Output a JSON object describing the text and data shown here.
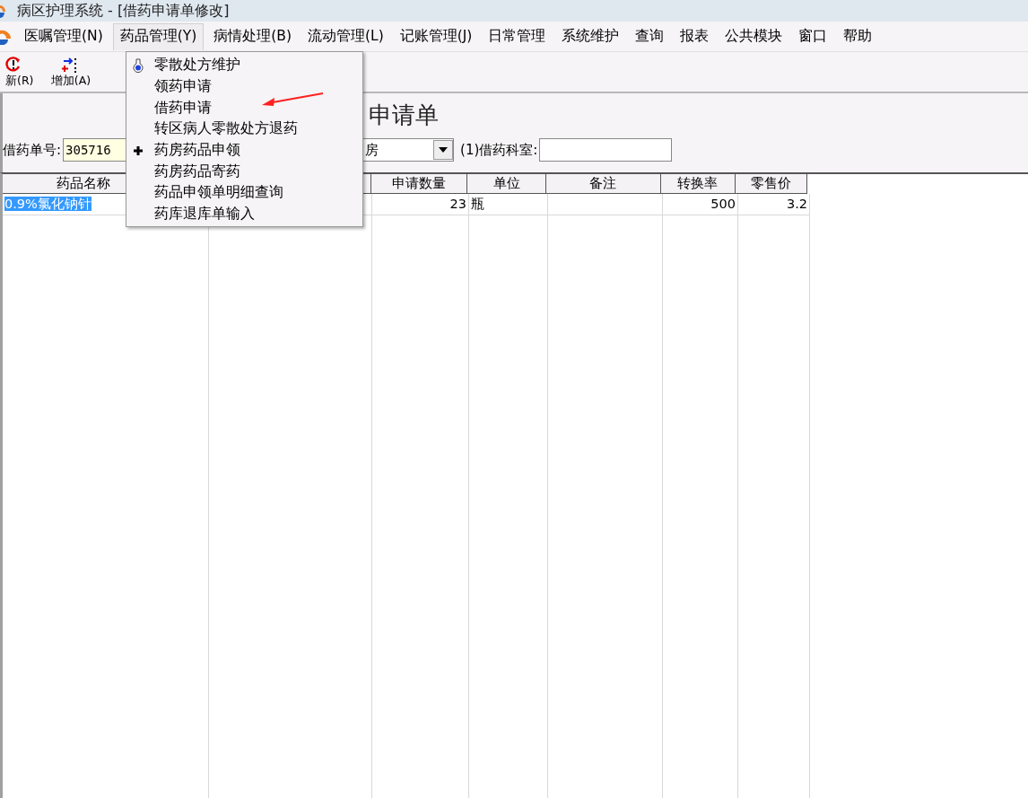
{
  "window": {
    "title": "病区护理系统 - [借药申请单修改]"
  },
  "menubar": [
    {
      "label": "医嘱管理(N)",
      "selected": false
    },
    {
      "label": "药品管理(Y)",
      "selected": true
    },
    {
      "label": "病情处理(B)",
      "selected": false
    },
    {
      "label": "流动管理(L)",
      "selected": false
    },
    {
      "label": "记账管理(J)",
      "selected": false
    },
    {
      "label": "日常管理",
      "selected": false
    },
    {
      "label": "系统维护",
      "selected": false
    },
    {
      "label": "查询",
      "selected": false
    },
    {
      "label": "报表",
      "selected": false
    },
    {
      "label": "公共模块",
      "selected": false
    },
    {
      "label": "窗口",
      "selected": false
    },
    {
      "label": "帮助",
      "selected": false
    }
  ],
  "toolbar": [
    {
      "kind": "refresh",
      "label": "新(R)"
    },
    {
      "kind": "add",
      "label": "增加(A)"
    }
  ],
  "form": {
    "title": "申请单",
    "order_no_label": "借药单号:",
    "order_no": "305716",
    "pharmacy": "房",
    "dept_label": "(1)借药科室:"
  },
  "table": {
    "columns": [
      "药品名称",
      "",
      "申请数量",
      "单位",
      "备注",
      "转换率",
      "零售价"
    ],
    "rows": [
      {
        "selected": true,
        "cells": [
          "0.9%氯化钠针",
          "",
          "23",
          "瓶",
          "",
          "500",
          "3.2"
        ]
      }
    ]
  },
  "dropdown_menu": [
    {
      "kind": "flask",
      "label": "零散处方维护"
    },
    {
      "kind": "plain",
      "label": "领药申请"
    },
    {
      "kind": "plain",
      "label": "借药申请"
    },
    {
      "kind": "plain",
      "label": "转区病人零散处方退药"
    },
    {
      "kind": "plus",
      "label": "药房药品申领"
    },
    {
      "kind": "plain",
      "label": "药房药品寄药"
    },
    {
      "kind": "plain",
      "label": "药品申领单明细查询"
    },
    {
      "kind": "plain",
      "label": "药库退库单输入"
    }
  ]
}
